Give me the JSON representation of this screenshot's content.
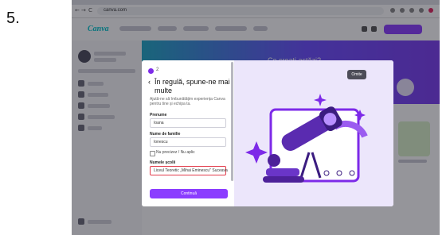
{
  "step_label": "5.",
  "browser": {
    "back": "←",
    "forward": "→",
    "reload": "C",
    "url": "canva.com"
  },
  "app": {
    "logo": "Canva",
    "hero_title": "Ce creați astăzi?"
  },
  "modal": {
    "step_indicator": "2",
    "back_icon": "‹",
    "title": "În regulă, spune-ne mai multe",
    "description": "Ajută-ne să îmbunătățim experiența Canva pentru tine și echipa ta.",
    "first_name_label": "Prenume",
    "first_name_value": "Ioana",
    "last_name_label": "Nume de familie",
    "last_name_value": "Ionescu",
    "checkbox_label": "Nu precizez / Nu aplic",
    "school_label": "Numele școlii",
    "school_value": "Liceul Teoretic „Mihai Eminescu\" Suceava",
    "continue_label": "Continuă",
    "skip_label": "Omite"
  },
  "colors": {
    "brand": "#8b3dff",
    "logo": "#00c4cc",
    "illustration": "#7d2ae8"
  }
}
